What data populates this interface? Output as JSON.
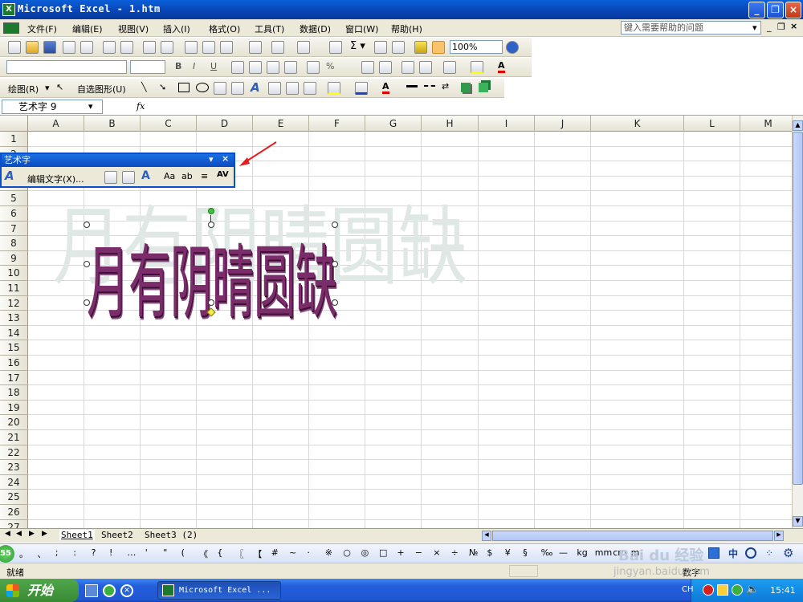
{
  "window": {
    "title": "Microsoft Excel - 1.htm",
    "icon": "excel-icon"
  },
  "menu": {
    "items": [
      "文件(F)",
      "编辑(E)",
      "视图(V)",
      "插入(I)",
      "格式(O)",
      "工具(T)",
      "数据(D)",
      "窗口(W)",
      "帮助(H)"
    ],
    "help_placeholder": "键入需要帮助的问题"
  },
  "toolbar": {
    "zoom": "100%"
  },
  "drawing": {
    "draw_label": "绘图(R)",
    "autoshape_label": "自选图形(U)"
  },
  "formula": {
    "name_box": "艺术字 9",
    "fx": "fx"
  },
  "columns": [
    "A",
    "B",
    "C",
    "D",
    "E",
    "F",
    "G",
    "H",
    "I",
    "J",
    "K",
    "L",
    "M"
  ],
  "rows": [
    "1",
    "2",
    "3",
    "4",
    "5",
    "6",
    "7",
    "8",
    "9",
    "10",
    "11",
    "12",
    "13",
    "14",
    "15",
    "16",
    "17",
    "18",
    "19",
    "20",
    "21",
    "22",
    "23",
    "24",
    "25",
    "26",
    "27"
  ],
  "wordart_toolbar": {
    "title": "艺术字",
    "edit_text": "编辑文字(X)..."
  },
  "wordart_text": "月有阴晴圆缺",
  "sheets": [
    "Sheet1",
    "Sheet2",
    "Sheet3 (2)"
  ],
  "ime": {
    "counter": "55",
    "symbols": [
      "。",
      "、",
      ";",
      ":",
      "?",
      "!",
      "…",
      "'",
      "\"",
      "(",
      "《",
      "{",
      "〖",
      "【",
      "#",
      "~",
      "·",
      "※",
      "○",
      "◎",
      "□",
      "+",
      "−",
      "×",
      "÷",
      "№",
      "$",
      "¥",
      "§",
      "‰",
      "—",
      "kg",
      "mm",
      "cm",
      "m"
    ]
  },
  "status": {
    "ready": "就绪",
    "mode": "数字"
  },
  "taskbar": {
    "start": "开始",
    "task": "Microsoft Excel ...",
    "lang": "CH",
    "clock": "15:41",
    "ime_zh": "中"
  },
  "watermark": {
    "logo": "Bai du 经验",
    "url": "jingyan.baidu.com"
  },
  "colors": {
    "title_blue": "#0a4fc8",
    "wordart_fill": "#7a2d6a",
    "xp_green": "#3a8a34"
  }
}
